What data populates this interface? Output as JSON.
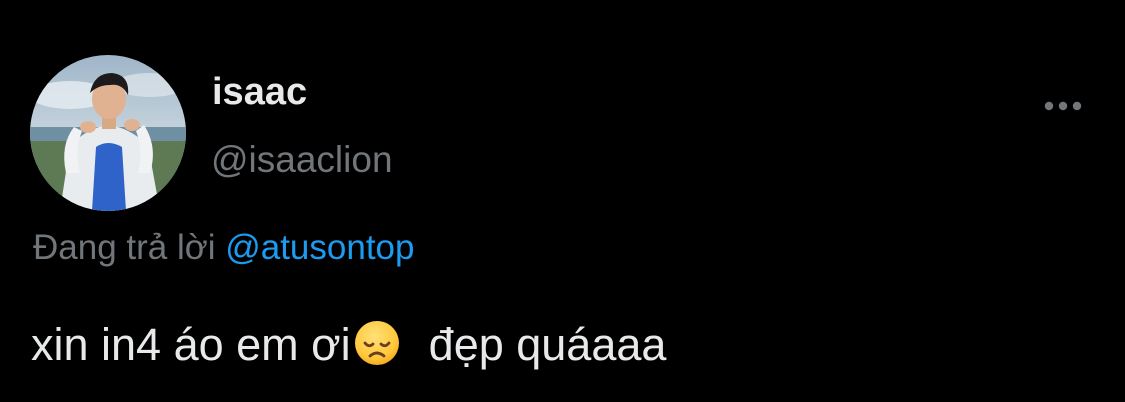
{
  "tweet": {
    "display_name": "isaac",
    "handle": "@isaaclion",
    "reply_prefix": "Đang trả lời",
    "reply_mention": "@atusontop",
    "text_before_emoji": "xin in4 áo em ơi",
    "emoji": "disappointed-face",
    "text_after_emoji": "đẹp quáaaa"
  },
  "icons": {
    "more": "more-horizontal-icon"
  },
  "colors": {
    "background": "#000000",
    "primary_text": "#e7e9ea",
    "secondary_text": "#71767b",
    "link": "#1d9bf0"
  }
}
